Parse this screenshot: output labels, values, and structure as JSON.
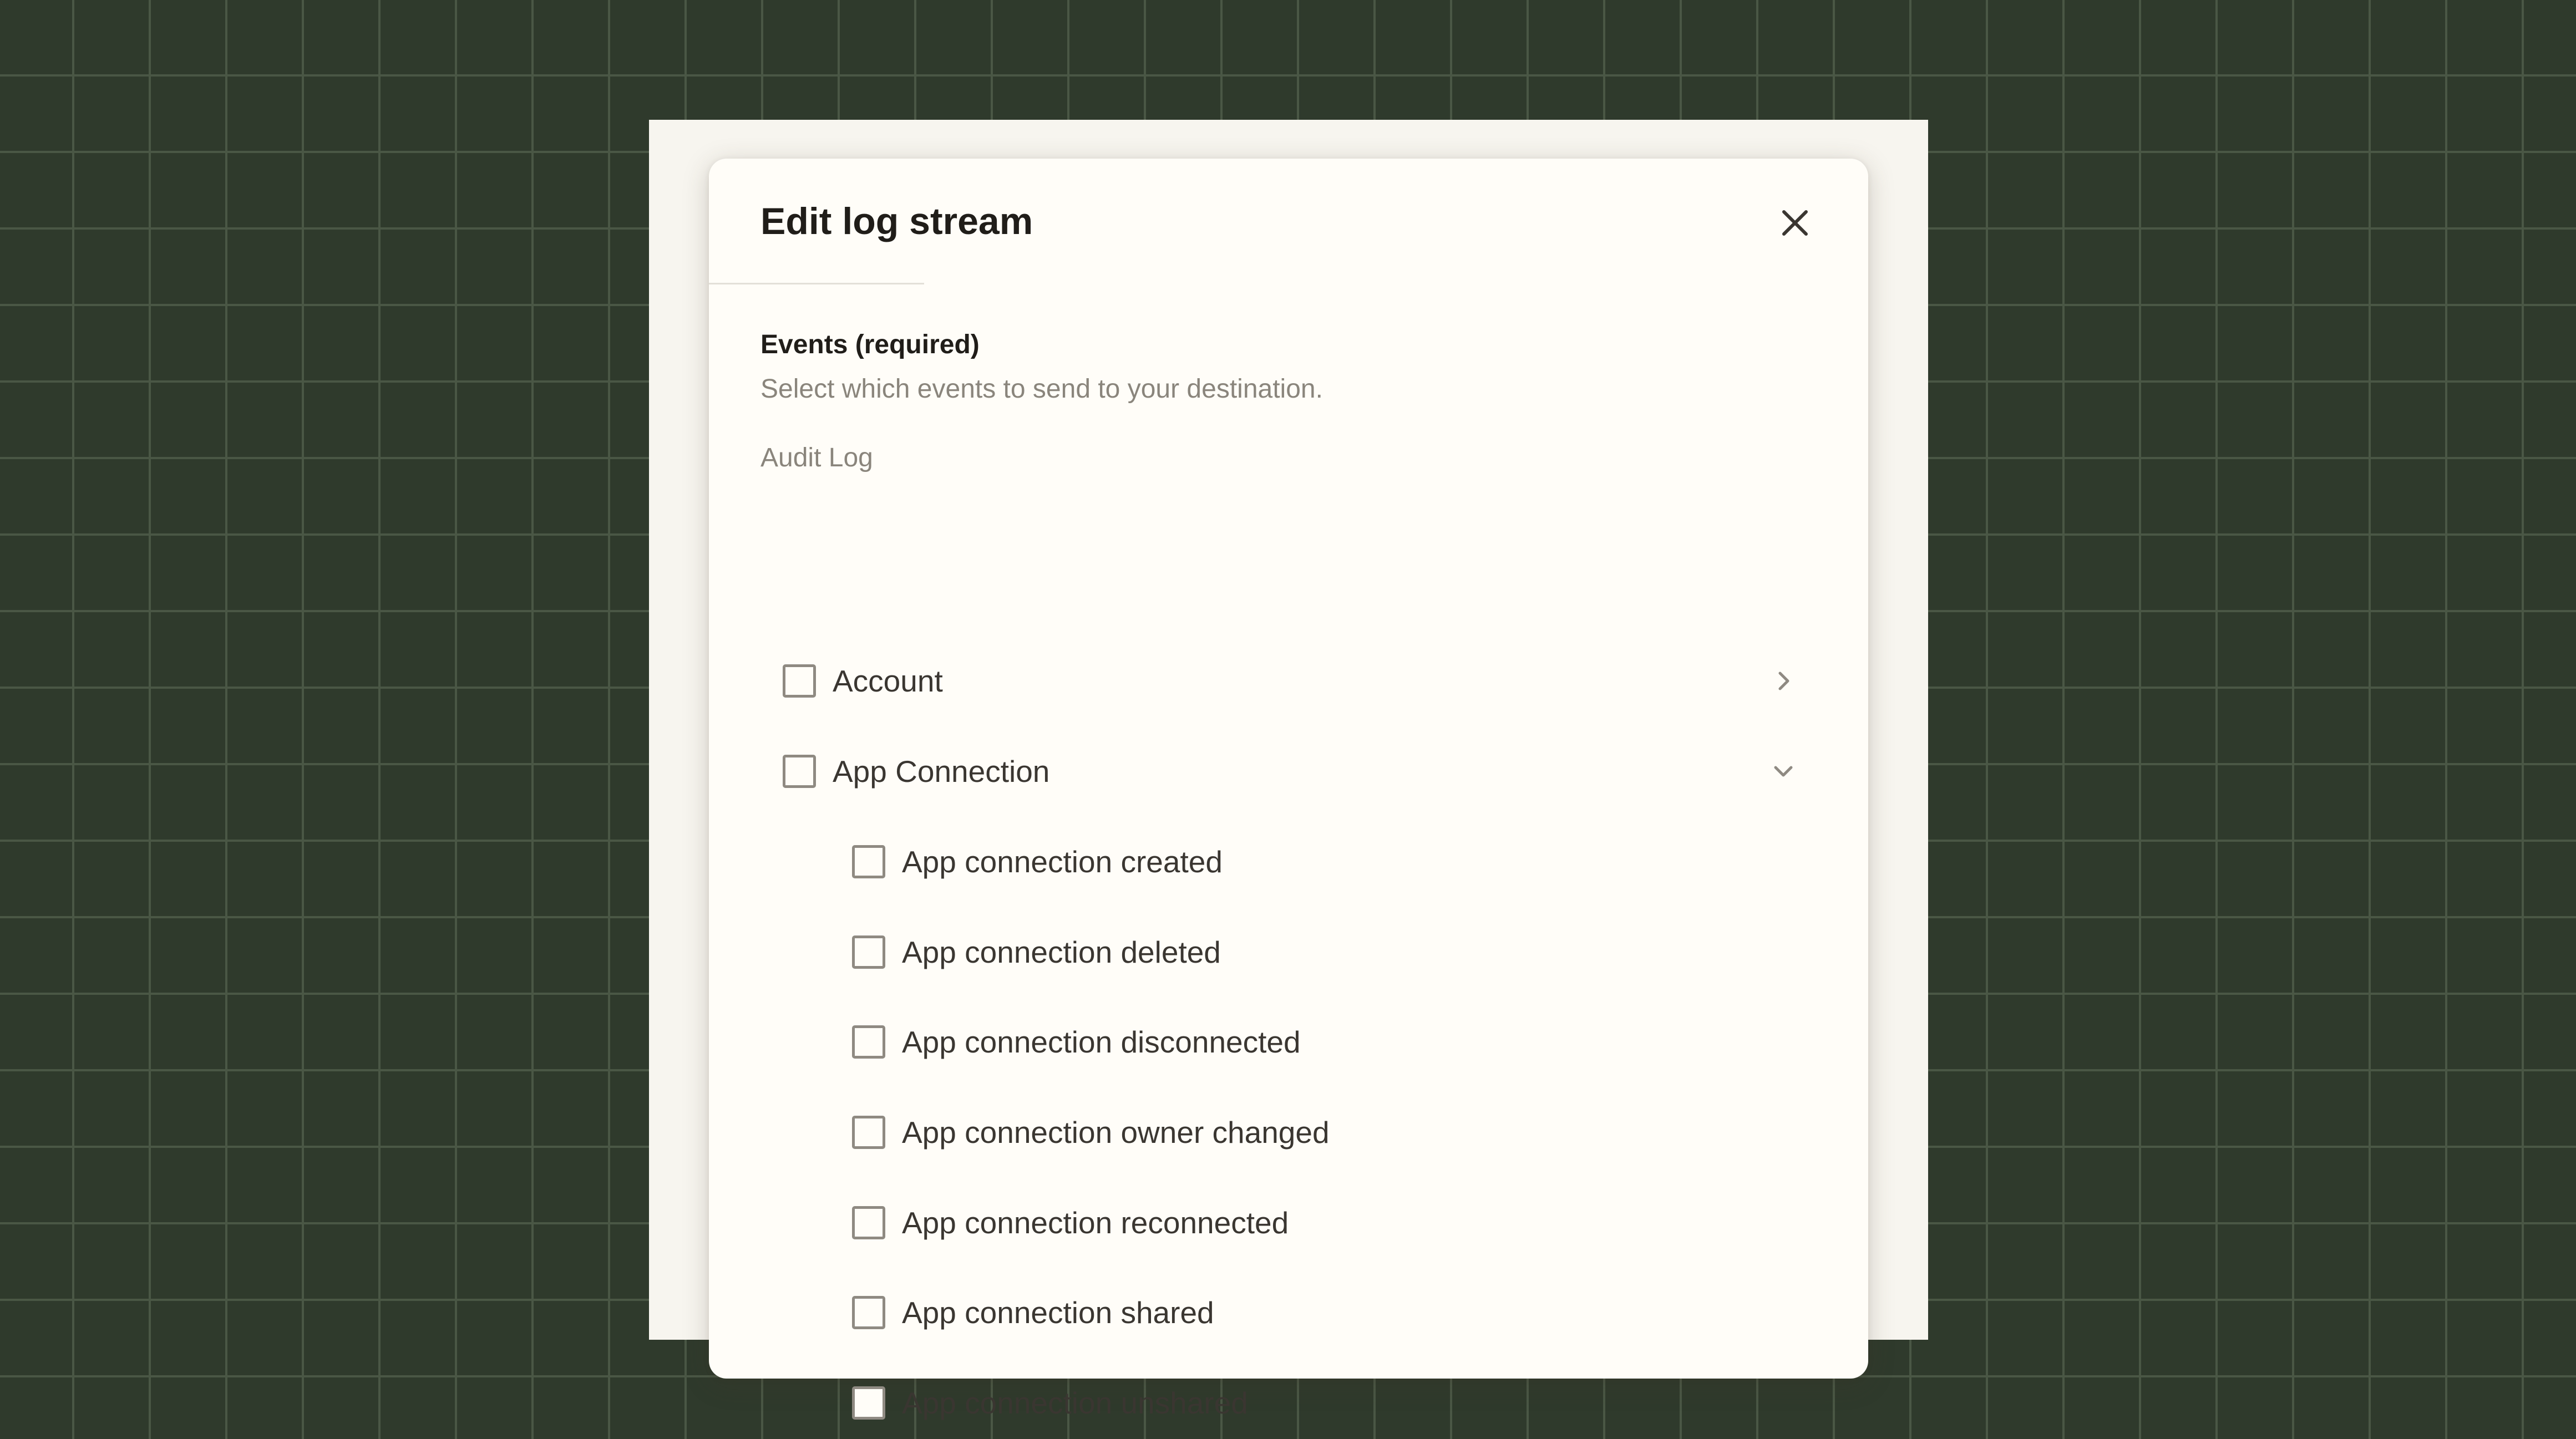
{
  "modal": {
    "title": "Edit log stream"
  },
  "events": {
    "title": "Events (required)",
    "description": "Select which events to send to your destination.",
    "group_label": "Audit Log",
    "categories": [
      {
        "label": "Account",
        "expanded": false,
        "checked": false
      },
      {
        "label": "App Connection",
        "expanded": true,
        "checked": false,
        "items": [
          {
            "label": "App connection created",
            "checked": false
          },
          {
            "label": "App connection deleted",
            "checked": false
          },
          {
            "label": "App connection disconnected",
            "checked": false
          },
          {
            "label": "App connection owner changed",
            "checked": false
          },
          {
            "label": "App connection reconnected",
            "checked": false
          },
          {
            "label": "App connection shared",
            "checked": false
          },
          {
            "label": "App connection unshared",
            "checked": false
          }
        ]
      }
    ]
  },
  "icons": {
    "close": "close-icon",
    "collapsed": "chevron-right-icon",
    "expanded": "chevron-down-icon"
  },
  "colors": {
    "background": "#2f3a2c",
    "grid_line": "#4a5745",
    "modal_bg": "#fffdf8",
    "text_primary": "#201d19",
    "text_muted": "#8a857c",
    "checkbox_border": "#8f8a82"
  }
}
